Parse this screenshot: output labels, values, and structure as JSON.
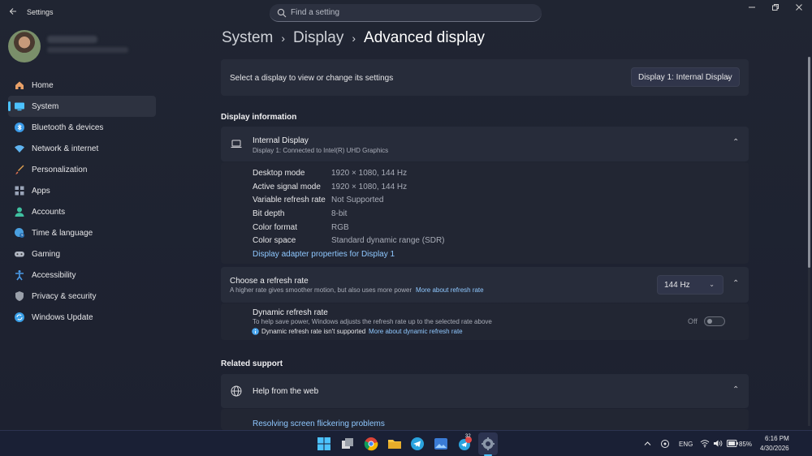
{
  "window": {
    "app_title": "Settings",
    "search_placeholder": "Find a setting"
  },
  "sidebar": {
    "items": [
      {
        "label": "Home",
        "icon": "home-icon",
        "color": "#e8a068"
      },
      {
        "label": "System",
        "icon": "system-icon",
        "color": "#4cc2ff",
        "active": true
      },
      {
        "label": "Bluetooth & devices",
        "icon": "bluetooth-icon",
        "color": "#3b9be8"
      },
      {
        "label": "Network & internet",
        "icon": "wifi-icon",
        "color": "#5fb4f0"
      },
      {
        "label": "Personalization",
        "icon": "brush-icon",
        "color": "#e0a050"
      },
      {
        "label": "Apps",
        "icon": "apps-icon",
        "color": "#9aa4b8"
      },
      {
        "label": "Accounts",
        "icon": "account-icon",
        "color": "#3fc0a0"
      },
      {
        "label": "Time & language",
        "icon": "globe-clock-icon",
        "color": "#4aa0e0"
      },
      {
        "label": "Gaming",
        "icon": "gamepad-icon",
        "color": "#b0b6c2"
      },
      {
        "label": "Accessibility",
        "icon": "accessibility-icon",
        "color": "#4a9ae8"
      },
      {
        "label": "Privacy & security",
        "icon": "shield-icon",
        "color": "#9aa0aa"
      },
      {
        "label": "Windows Update",
        "icon": "update-icon",
        "color": "#3aa0e8"
      }
    ]
  },
  "breadcrumb": {
    "items": [
      "System",
      "Display"
    ],
    "current": "Advanced display"
  },
  "select_display": {
    "label": "Select a display to view or change its settings",
    "value": "Display 1: Internal Display"
  },
  "display_info": {
    "section_title": "Display information",
    "name": "Internal Display",
    "subtitle": "Display 1: Connected to Intel(R) UHD Graphics",
    "rows": [
      {
        "key": "Desktop mode",
        "value": "1920 × 1080, 144 Hz"
      },
      {
        "key": "Active signal mode",
        "value": "1920 × 1080, 144 Hz"
      },
      {
        "key": "Variable refresh rate",
        "value": "Not Supported"
      },
      {
        "key": "Bit depth",
        "value": "8-bit"
      },
      {
        "key": "Color format",
        "value": "RGB"
      },
      {
        "key": "Color space",
        "value": "Standard dynamic range (SDR)"
      }
    ],
    "adapter_link": "Display adapter properties for Display 1"
  },
  "refresh_rate": {
    "title": "Choose a refresh rate",
    "description": "A higher rate gives smoother motion, but also uses more power",
    "more_link": "More about refresh rate",
    "value": "144 Hz",
    "dynamic": {
      "title": "Dynamic refresh rate",
      "description": "To help save power, Windows adjusts the refresh rate up to the selected rate above",
      "notice": "Dynamic refresh rate isn't supported",
      "notice_link": "More about dynamic refresh rate",
      "toggle_label": "Off"
    }
  },
  "related_support": {
    "section_title": "Related support",
    "help_title": "Help from the web",
    "link": "Resolving screen flickering problems"
  },
  "taskbar": {
    "telegram_badge": "32",
    "language": "ENG",
    "battery": "85%",
    "time": "6:16 PM",
    "date": "4/30/2026"
  }
}
